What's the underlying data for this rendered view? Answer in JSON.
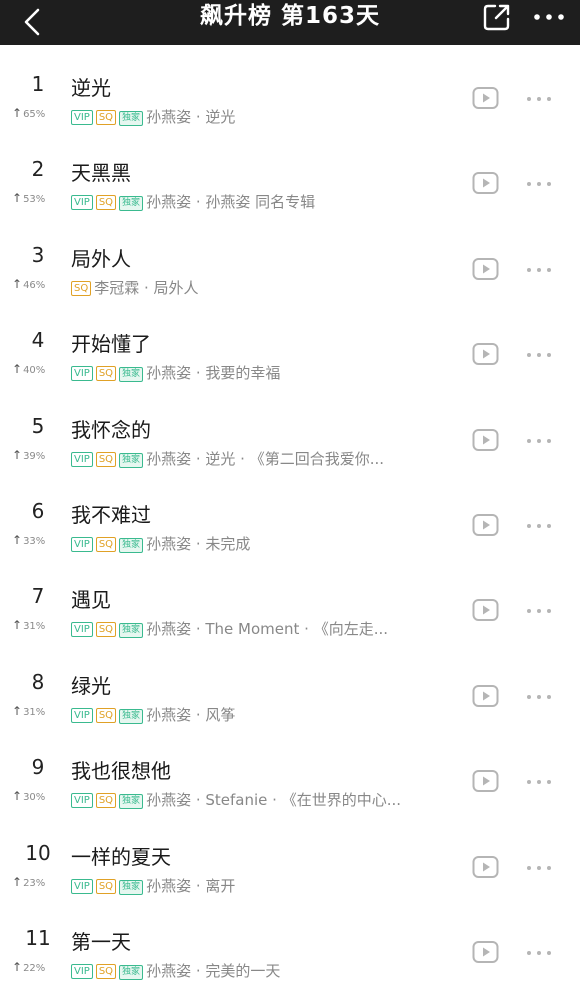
{
  "header": {
    "title": "飙升榜 第163天"
  },
  "songs": [
    {
      "rank": "1",
      "title": "逆光",
      "trend": "65%",
      "tags": [
        "VIP",
        "SQ",
        "独家"
      ],
      "artist": "孙燕姿",
      "sep": " · ",
      "album": "逆光"
    },
    {
      "rank": "2",
      "title": "天黑黑",
      "trend": "53%",
      "tags": [
        "VIP",
        "SQ",
        "独家"
      ],
      "artist": "孙燕姿",
      "sep": " · ",
      "album": "孙燕姿 同名专辑"
    },
    {
      "rank": "3",
      "title": "局外人",
      "trend": "46%",
      "tags": [
        "SQ"
      ],
      "artist": "李冠霖",
      "sep": " · ",
      "album": "局外人"
    },
    {
      "rank": "4",
      "title": "开始懂了",
      "trend": "40%",
      "tags": [
        "VIP",
        "SQ",
        "独家"
      ],
      "artist": "孙燕姿",
      "sep": " · ",
      "album": "我要的幸福"
    },
    {
      "rank": "5",
      "title": "我怀念的",
      "trend": "39%",
      "tags": [
        "VIP",
        "SQ",
        "独家"
      ],
      "artist": "孙燕姿",
      "sep": " · ",
      "album": "逆光 · 《第二回合我爱你..."
    },
    {
      "rank": "6",
      "title": "我不难过",
      "trend": "33%",
      "tags": [
        "VIP",
        "SQ",
        "独家"
      ],
      "artist": "孙燕姿",
      "sep": " · ",
      "album": "未完成"
    },
    {
      "rank": "7",
      "title": "遇见",
      "trend": "31%",
      "tags": [
        "VIP",
        "SQ",
        "独家"
      ],
      "artist": "孙燕姿",
      "sep": " · ",
      "album": "The Moment · 《向左走..."
    },
    {
      "rank": "8",
      "title": "绿光",
      "trend": "31%",
      "tags": [
        "VIP",
        "SQ",
        "独家"
      ],
      "artist": "孙燕姿",
      "sep": " · ",
      "album": "风筝"
    },
    {
      "rank": "9",
      "title": "我也很想他",
      "trend": "30%",
      "tags": [
        "VIP",
        "SQ",
        "独家"
      ],
      "artist": "孙燕姿",
      "sep": " · ",
      "album": "Stefanie · 《在世界的中心..."
    },
    {
      "rank": "10",
      "title": "一样的夏天",
      "trend": "23%",
      "tags": [
        "VIP",
        "SQ",
        "独家"
      ],
      "artist": "孙燕姿",
      "sep": " · ",
      "album": "离开"
    },
    {
      "rank": "11",
      "title": "第一天",
      "trend": "22%",
      "tags": [
        "VIP",
        "SQ",
        "独家"
      ],
      "artist": "孙燕姿",
      "sep": " · ",
      "album": "完美的一天"
    }
  ]
}
